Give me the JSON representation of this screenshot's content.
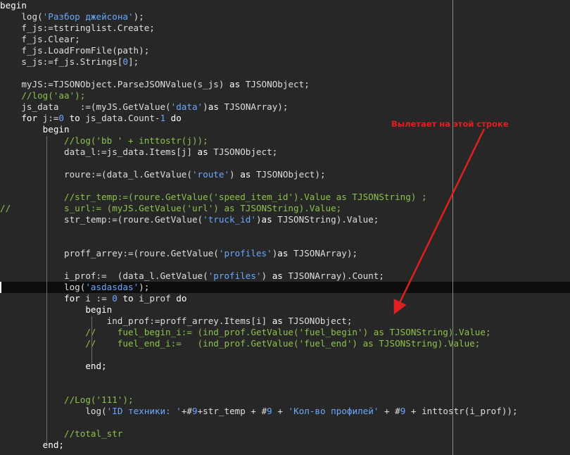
{
  "annotation": {
    "text": "Вылетает на этой строке",
    "color": "#e21f1f"
  },
  "code_lines": [
    [
      [
        "kw",
        "begin"
      ]
    ],
    [
      [
        "fn",
        "    log("
      ],
      [
        "str",
        "'Разбор джейсона'"
      ],
      [
        "fn",
        ");"
      ]
    ],
    [
      [
        "fn",
        "    f_js:=tstringlist.Create;"
      ]
    ],
    [
      [
        "fn",
        "    f_js.Clear;"
      ]
    ],
    [
      [
        "fn",
        "    f_js.LoadFromFile(path);"
      ]
    ],
    [
      [
        "fn",
        "    s_js:=f_js.Strings["
      ],
      [
        "num",
        "0"
      ],
      [
        "fn",
        "];"
      ]
    ],
    [],
    [
      [
        "fn",
        "    myJS:=TJSONObject.ParseJSONValue(s_js) "
      ],
      [
        "kw",
        "as"
      ],
      [
        "fn",
        " TJSONObject;"
      ]
    ],
    [
      [
        "cmt",
        "    //log('aa');"
      ]
    ],
    [
      [
        "fn",
        "    js_data    :=(myJS.GetValue("
      ],
      [
        "str",
        "'data'"
      ],
      [
        "fn",
        ")"
      ],
      [
        "kw",
        "as"
      ],
      [
        "fn",
        " TJSONArray);"
      ]
    ],
    [
      [
        "kw",
        "    for"
      ],
      [
        "fn",
        " j:="
      ],
      [
        "num",
        "0"
      ],
      [
        "kw",
        " to"
      ],
      [
        "fn",
        " js_data.Count-"
      ],
      [
        "num",
        "1"
      ],
      [
        "kw",
        " do"
      ]
    ],
    [
      [
        "kw",
        "        begin"
      ]
    ],
    [
      [
        "cmt",
        "            //log('bb ' + inttostr(j));"
      ]
    ],
    [
      [
        "fn",
        "            data_l:=js_data.Items[j] "
      ],
      [
        "kw",
        "as"
      ],
      [
        "fn",
        " TJSONObject;"
      ]
    ],
    [],
    [
      [
        "fn",
        "            roure:=(data_l.GetValue("
      ],
      [
        "str",
        "'route'"
      ],
      [
        "fn",
        ") "
      ],
      [
        "kw",
        "as"
      ],
      [
        "fn",
        " TJSONObject);"
      ]
    ],
    [],
    [
      [
        "cmt",
        "            //str_temp:=(roure.GetValue('speed_item_id').Value as TJSONString) ;"
      ]
    ],
    [
      [
        "cmt",
        "//          s_url:= (myJS.GetValue('url') as TJSONString).Value;"
      ]
    ],
    [
      [
        "fn",
        "            str_temp:=(roure.GetValue("
      ],
      [
        "str",
        "'truck_id'"
      ],
      [
        "fn",
        ")"
      ],
      [
        "kw",
        "as"
      ],
      [
        "fn",
        " TJSONString).Value;"
      ]
    ],
    [],
    [],
    [
      [
        "fn",
        "            proff_arrey:=(roure.GetValue("
      ],
      [
        "str",
        "'profiles'"
      ],
      [
        "fn",
        ")"
      ],
      [
        "kw",
        "as"
      ],
      [
        "fn",
        " TJSONArray);"
      ]
    ],
    [],
    [
      [
        "fn",
        "            i_prof:=  (data_l.GetValue("
      ],
      [
        "str",
        "'profiles'"
      ],
      [
        "fn",
        ") "
      ],
      [
        "kw",
        "as"
      ],
      [
        "fn",
        " TJSONArray).Count;"
      ]
    ],
    [
      [
        "fn",
        "            log("
      ],
      [
        "str",
        "'asdasdas'"
      ],
      [
        "fn",
        ");"
      ]
    ],
    [
      [
        "kw",
        "            for"
      ],
      [
        "fn",
        " i := "
      ],
      [
        "num",
        "0"
      ],
      [
        "kw",
        " to"
      ],
      [
        "fn",
        " i_prof "
      ],
      [
        "kw",
        "do"
      ]
    ],
    [
      [
        "kw",
        "                begin"
      ]
    ],
    [
      [
        "fn",
        "                    ind_prof:=proff_arrey.Items[i] "
      ],
      [
        "kw",
        "as"
      ],
      [
        "fn",
        " TJSONObject;"
      ]
    ],
    [
      [
        "cmt",
        "                //    fuel_begin_i:= (ind_prof.GetValue('fuel_begin') as TJSONString).Value;"
      ]
    ],
    [
      [
        "cmt",
        "                //    fuel_end_i:=   (ind_prof.GetValue('fuel_end') as TJSONString).Value;"
      ]
    ],
    [],
    [
      [
        "kw",
        "                end;"
      ]
    ],
    [],
    [],
    [
      [
        "cmt",
        "            //Log('111');"
      ]
    ],
    [
      [
        "fn",
        "                log("
      ],
      [
        "str",
        "'ID техники: '"
      ],
      [
        "fn",
        "+#"
      ],
      [
        "num",
        "9"
      ],
      [
        "fn",
        "+str_temp + #"
      ],
      [
        "num",
        "9"
      ],
      [
        "fn",
        " + "
      ],
      [
        "str",
        "'Кол-во профилей'"
      ],
      [
        "fn",
        " + #"
      ],
      [
        "num",
        "9"
      ],
      [
        "fn",
        " + inttostr(i_prof));"
      ]
    ],
    [],
    [
      [
        "cmt",
        "            //total_str"
      ]
    ],
    [
      [
        "kw",
        "        end;"
      ]
    ]
  ]
}
